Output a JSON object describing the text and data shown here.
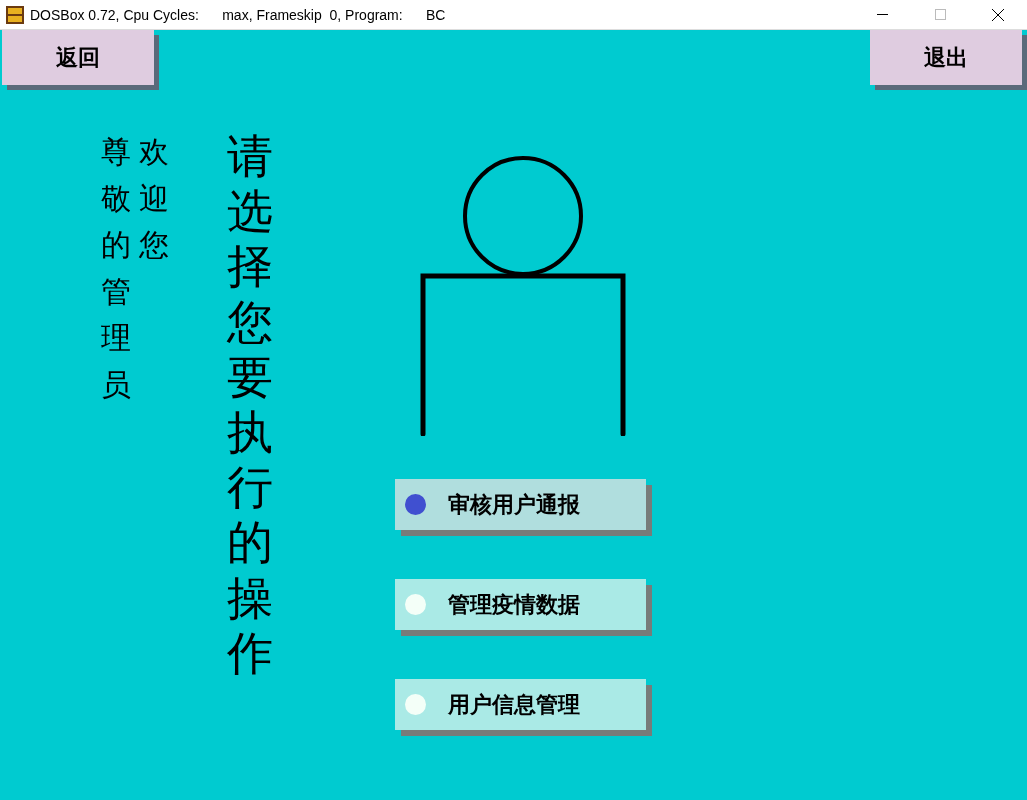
{
  "window": {
    "title": "DOSBox 0.72, Cpu Cycles:      max, Frameskip  0, Program:      BC"
  },
  "back_button": "返回",
  "exit_button": "退出",
  "greeting_columns": [
    "尊敬的管理员",
    "欢迎您"
  ],
  "prompt": "请选择您要执行的操作",
  "options": [
    {
      "label": "审核用户通报",
      "selected": true
    },
    {
      "label": "管理疫情数据",
      "selected": false
    },
    {
      "label": "用户信息管理",
      "selected": false
    }
  ]
}
